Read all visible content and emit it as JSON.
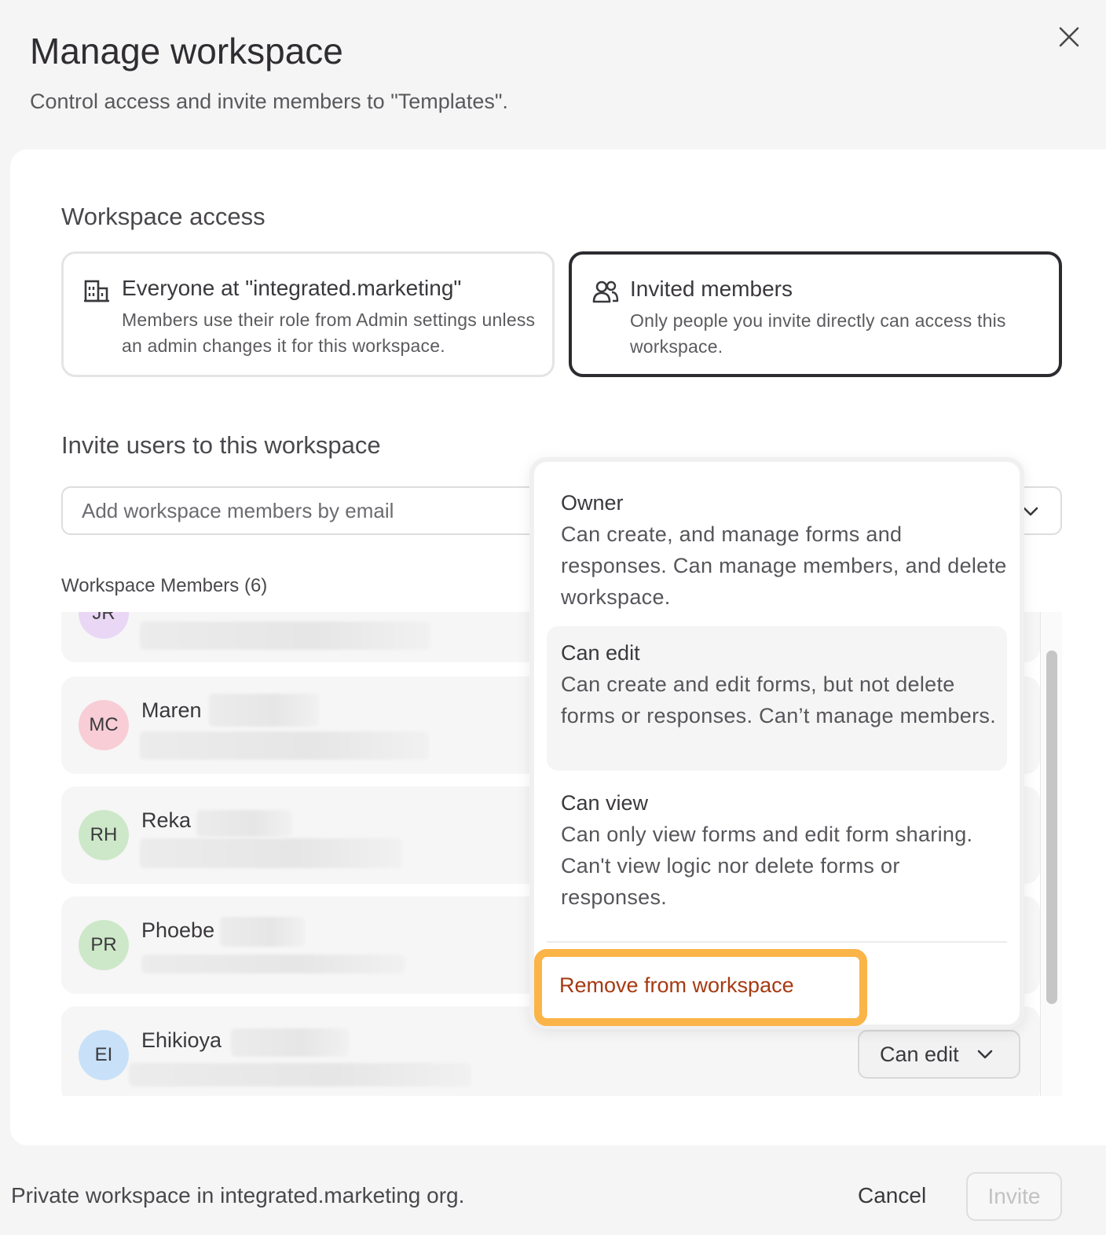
{
  "dialog": {
    "title": "Manage workspace",
    "subtitle": "Control access and invite members to \"Templates\"."
  },
  "access": {
    "heading": "Workspace access",
    "options": [
      {
        "title": "Everyone at \"integrated.marketing\"",
        "description": "Members use their role from Admin settings unless an admin changes it for this workspace.",
        "icon": "building-icon",
        "selected": false
      },
      {
        "title": "Invited members",
        "description": "Only people you invite directly can access this workspace.",
        "icon": "users-icon",
        "selected": true
      }
    ]
  },
  "invite": {
    "heading": "Invite users to this workspace",
    "placeholder": "Add workspace members by email"
  },
  "members": {
    "label": "Workspace Members (6)",
    "rows": [
      {
        "initials": "JR",
        "name": "",
        "avatar_color": "#ead7f5"
      },
      {
        "initials": "MC",
        "name": "Maren",
        "avatar_color": "#f8cdd6"
      },
      {
        "initials": "RH",
        "name": "Reka",
        "avatar_color": "#cde8c8"
      },
      {
        "initials": "PR",
        "name": "Phoebe",
        "avatar_color": "#cde8c8"
      },
      {
        "initials": "EI",
        "name": "Ehikioya",
        "avatar_color": "#c8e1f8"
      }
    ],
    "role_button": "Can edit"
  },
  "role_menu": {
    "options": [
      {
        "title": "Owner",
        "description": "Can create, and manage forms and responses. Can manage members, and delete workspace."
      },
      {
        "title": "Can edit",
        "description": "Can create and edit forms, but not delete forms or responses. Can’t manage members."
      },
      {
        "title": "Can view",
        "description": "Can only view forms and edit form sharing. Can't view logic nor delete forms or responses."
      }
    ],
    "remove_label": "Remove from workspace",
    "highlight_color": "#fbb447",
    "danger_color": "#a63a12"
  },
  "footer": {
    "note": "Private workspace in integrated.marketing org.",
    "cancel": "Cancel",
    "invite": "Invite"
  }
}
